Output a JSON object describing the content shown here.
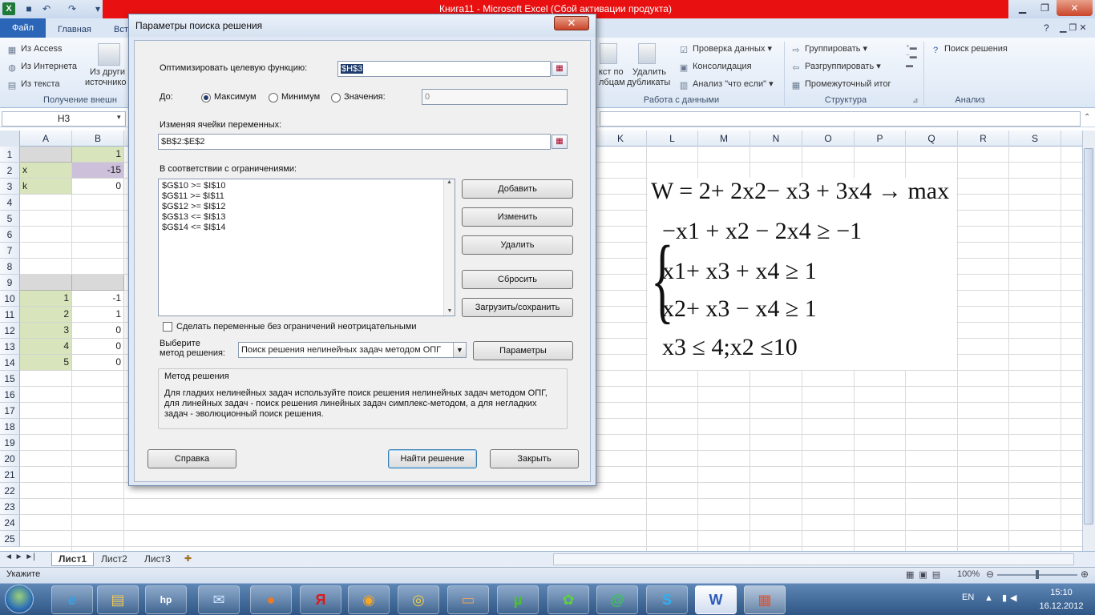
{
  "window": {
    "title": "Книга11  -  Microsoft Excel (Сбой активации продукта)",
    "excel_logo": "X"
  },
  "ribbon": {
    "file_tab": "Файл",
    "tabs": [
      "Главная",
      "Вст"
    ],
    "external": {
      "items": [
        "Из Access",
        "Из Интернета",
        "Из текста"
      ],
      "other_line1": "Из други",
      "other_line2": "источнико",
      "group_label": "Получение внешн"
    },
    "datatools": {
      "text_cols_line1": "кст по",
      "text_cols_line2": "лбцам",
      "remove_dup_line1": "Удалить",
      "remove_dup_line2": "дубликаты",
      "items": [
        "Проверка данных",
        "Консолидация",
        "Анализ \"что если\""
      ],
      "group_label": "Работа с данными"
    },
    "outline": {
      "items": [
        "Группировать",
        "Разгруппировать",
        "Промежуточный итог"
      ],
      "group_label": "Структура"
    },
    "analysis": {
      "solver": "Поиск решения",
      "group_label": "Анализ"
    }
  },
  "formula_bar": {
    "namebox": "H3"
  },
  "grid": {
    "columns": [
      "A",
      "B",
      "K",
      "L",
      "M",
      "N",
      "O",
      "P",
      "Q",
      "R",
      "S"
    ],
    "rows": [
      "1",
      "2",
      "3",
      "4",
      "5",
      "6",
      "7",
      "8",
      "9",
      "10",
      "11",
      "12",
      "13",
      "14",
      "15",
      "16",
      "17",
      "18",
      "19",
      "20",
      "21",
      "22",
      "23",
      "24",
      "25"
    ],
    "cells": {
      "B1": "1",
      "A2": "x",
      "B2": "-15",
      "A3": "k",
      "B3": "0",
      "A10": "1",
      "B10": "-1",
      "A11": "2",
      "B11": "1",
      "A12": "3",
      "B12": "0",
      "A13": "4",
      "B13": "0",
      "A14": "5",
      "B14": "0"
    },
    "colors": {
      "green": "#d8e4bc",
      "purple": "#ccc0da",
      "gray": "#d9d9d9"
    }
  },
  "math": {
    "line1": "W = 2+ 2x2− x3 + 3x4 → max",
    "line2": "−x1 + x2 − 2x4 ≥ −1",
    "line3": "x1+ x3 + x4 ≥ 1",
    "line4": "x2+ x3 − x4 ≥ 1",
    "line5": "x3 ≤ 4;x2 ≤10"
  },
  "sheets": {
    "nav": "◄ ► ►|",
    "tabs": [
      "Лист1",
      "Лист2",
      "Лист3"
    ]
  },
  "status": {
    "mode": "Укажите",
    "zoom": "100%"
  },
  "taskbar": {
    "lang": "EN",
    "time": "15:10",
    "date": "16.12.2012",
    "word_letter": "W"
  },
  "dialog": {
    "title": "Параметры поиска решения",
    "close": "✕",
    "objective_label": "Оптимизировать целевую функцию:",
    "objective_value": "$H$3",
    "to_label": "До:",
    "radio_max": "Максимум",
    "radio_min": "Минимум",
    "radio_value": "Значения:",
    "value_field": "0",
    "vars_label": "Изменяя ячейки переменных:",
    "vars_value": "$B$2:$E$2",
    "constraints_label": "В соответствии с ограничениями:",
    "constraints": [
      "$G$10 >= $I$10",
      "$G$11 >= $I$11",
      "$G$12 >= $I$12",
      "$G$13 <= $I$13",
      "$G$14 <= $I$14"
    ],
    "btn_add": "Добавить",
    "btn_change": "Изменить",
    "btn_delete": "Удалить",
    "btn_reset": "Сбросить",
    "btn_load": "Загрузить/сохранить",
    "nonneg_label": "Сделать переменные без ограничений неотрицательными",
    "method_label_1": "Выберите",
    "method_label_2": "метод решения:",
    "method_value": "Поиск решения нелинейных задач методом ОПГ",
    "btn_params": "Параметры",
    "method_group_title": "Метод решения",
    "method_desc": "Для гладких нелинейных задач используйте поиск решения нелинейных задач методом ОПГ, для линейных задач - поиск решения линейных задач симплекс-методом, а для негладких задач - эволюционный поиск решения.",
    "btn_help": "Справка",
    "btn_solve": "Найти решение",
    "btn_close": "Закрыть"
  }
}
